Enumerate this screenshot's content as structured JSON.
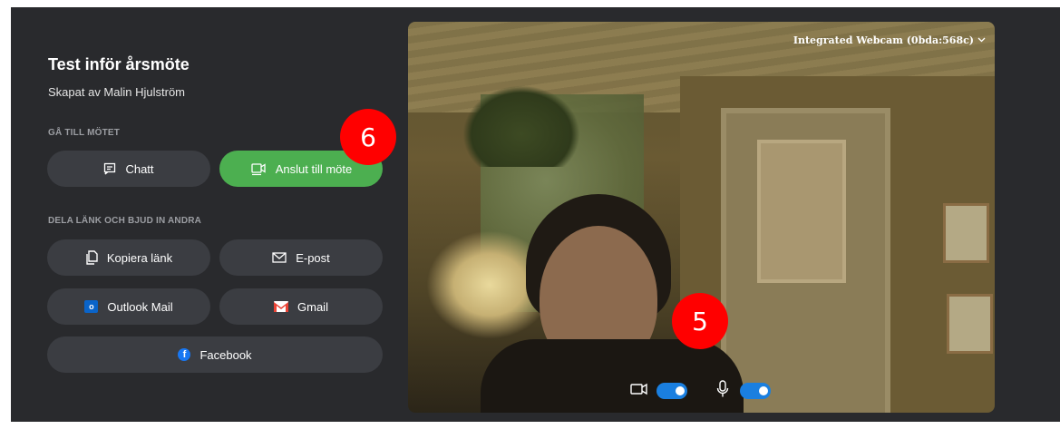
{
  "meeting": {
    "title": "Test inför årsmöte",
    "creator": "Skapat av Malin Hjulström"
  },
  "sections": {
    "join": "GÅ TILL MÖTET",
    "share": "DELA LÄNK OCH BJUD IN ANDRA"
  },
  "buttons": {
    "chat": "Chatt",
    "join": "Anslut till möte",
    "copy_link": "Kopiera länk",
    "email": "E-post",
    "outlook": "Outlook Mail",
    "gmail": "Gmail",
    "facebook": "Facebook"
  },
  "icons": {
    "chat": "chat-icon",
    "join": "video-join-icon",
    "copy_link": "copy-icon",
    "email": "mail-icon",
    "outlook": "outlook-icon",
    "gmail": "gmail-icon",
    "facebook": "facebook-icon",
    "camera": "camera-icon",
    "mic": "microphone-icon",
    "chevron": "chevron-down-icon"
  },
  "video": {
    "device": "Integrated Webcam (0bda:568c)",
    "camera_on": true,
    "mic_on": true
  },
  "annotations": {
    "marker_a": "6",
    "marker_b": "5"
  },
  "colors": {
    "background": "#292a2d",
    "button": "#3b3d42",
    "primary": "#4caf50",
    "toggle": "#1a7fe0",
    "marker": "#ff0000"
  }
}
